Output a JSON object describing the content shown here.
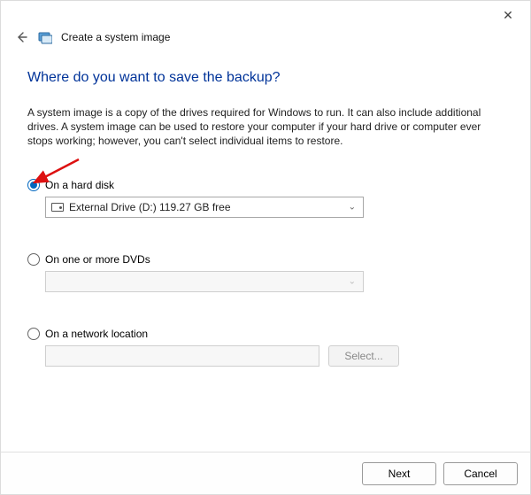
{
  "header": {
    "title": "Create a system image"
  },
  "main": {
    "question": "Where do you want to save the backup?",
    "description": "A system image is a copy of the drives required for Windows to run. It can also include additional drives. A system image can be used to restore your computer if your hard drive or computer ever stops working; however, you can't select individual items to restore."
  },
  "options": {
    "hard_disk": {
      "label": "On a hard disk",
      "checked": true,
      "selected_drive": "External Drive (D:)  119.27 GB free"
    },
    "dvds": {
      "label": "On one or more DVDs",
      "checked": false,
      "selected_drive": ""
    },
    "network": {
      "label": "On a network location",
      "checked": false,
      "path": "",
      "select_button": "Select..."
    }
  },
  "footer": {
    "next": "Next",
    "cancel": "Cancel"
  },
  "icons": {
    "close": "✕",
    "chevron_down": "⌄",
    "back_arrow": "←"
  }
}
